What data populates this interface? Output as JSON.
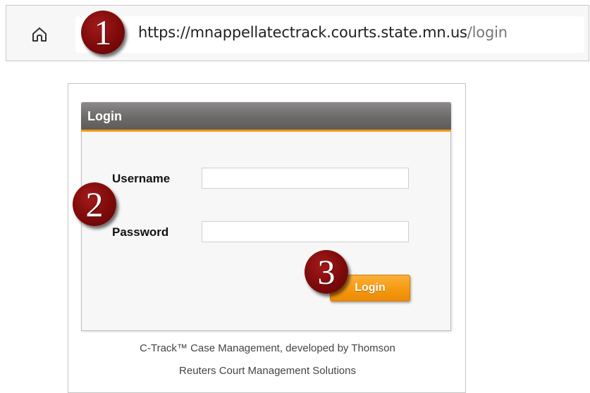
{
  "browser": {
    "url_host": "https://mnappellatectrack.courts.state.mn.us",
    "url_path": "/login",
    "home_icon": "home-icon"
  },
  "callouts": {
    "step1": "1",
    "step2": "2",
    "step3": "3"
  },
  "login_panel": {
    "title": "Login",
    "username_label": "Username",
    "username_value": "",
    "password_label": "Password",
    "password_value": "",
    "submit_label": "Login"
  },
  "footer": {
    "line1": "C-Track™ Case Management, developed by Thomson",
    "line2": "Reuters Court Management Solutions"
  },
  "colors": {
    "accent_orange": "#f39c12",
    "header_gray": "#6d6a6a",
    "callout_red": "#7e0a0a"
  }
}
